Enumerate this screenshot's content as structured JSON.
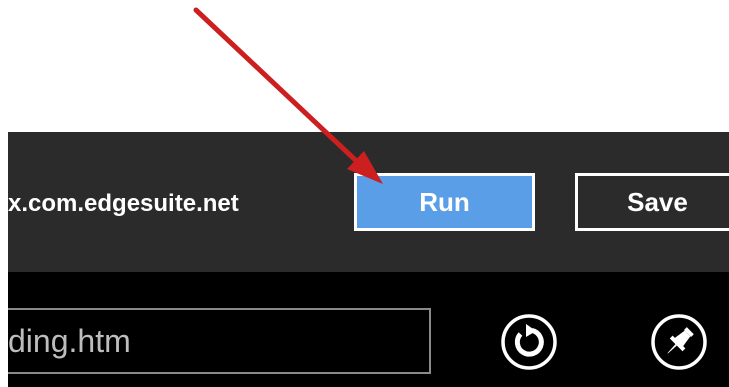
{
  "download_bar": {
    "filename": "x.com.edgesuite.net",
    "run_label": "Run",
    "save_label": "Save"
  },
  "address_bar": {
    "url_value": "ding.htm",
    "refresh_icon": "refresh-icon",
    "pin_icon": "pin-icon"
  },
  "annotation": {
    "arrow_color": "#cc1f1f"
  },
  "colors": {
    "run_button": "#5a9ee8",
    "bar_background": "#2b2b2b",
    "address_background": "#000000"
  }
}
